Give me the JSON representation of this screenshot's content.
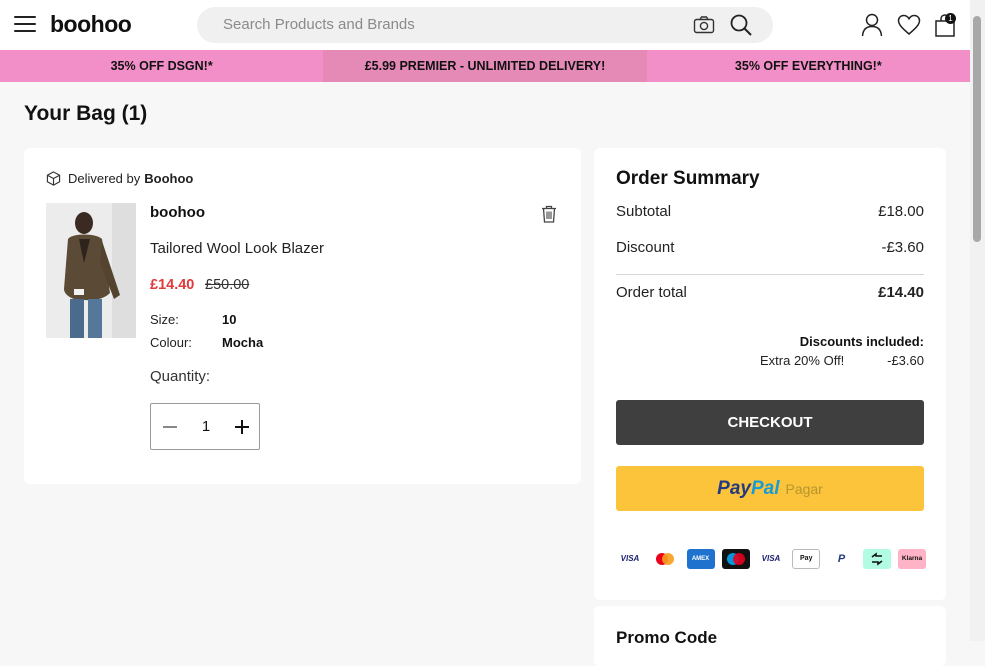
{
  "header": {
    "logo": "boohoo",
    "search_placeholder": "Search Products and Brands",
    "bag_count": "1"
  },
  "promo_bar": [
    "35% OFF DSGN!*",
    "£5.99 PREMIER - UNLIMITED DELIVERY!",
    "35% OFF EVERYTHING!*"
  ],
  "page": {
    "title": "Your Bag (1)"
  },
  "bag": {
    "delivered_by_label": "Delivered by",
    "delivered_by_name": "Boohoo",
    "item": {
      "brand": "boohoo",
      "name": "Tailored Wool Look Blazer",
      "price_now": "£14.40",
      "price_was": "£50.00",
      "size_label": "Size:",
      "size_value": "10",
      "colour_label": "Colour:",
      "colour_value": "Mocha",
      "quantity_label": "Quantity:",
      "quantity": "1"
    }
  },
  "summary": {
    "title": "Order Summary",
    "subtotal_label": "Subtotal",
    "subtotal_value": "£18.00",
    "discount_label": "Discount",
    "discount_value": "-£3.60",
    "total_label": "Order total",
    "total_value": "£14.40",
    "discounts_included_label": "Discounts included:",
    "discount_name": "Extra 20% Off!",
    "discount_amount": "-£3.60",
    "checkout_label": "CHECKOUT",
    "paypal_pay": "Pay",
    "paypal_pal": "Pal",
    "paypal_suffix": "Pagar",
    "payment_icons": [
      {
        "name": "visa-icon",
        "label": "VISA"
      },
      {
        "name": "mastercard-icon",
        "label": ""
      },
      {
        "name": "amex-icon",
        "label": "AMEX"
      },
      {
        "name": "maestro-icon",
        "label": ""
      },
      {
        "name": "visa-electron-icon",
        "label": "VISA"
      },
      {
        "name": "apple-pay-icon",
        "label": "Pay"
      },
      {
        "name": "paypal-icon",
        "label": "P"
      },
      {
        "name": "clearpay-icon",
        "label": ""
      },
      {
        "name": "klarna-icon",
        "label": "Klarna"
      }
    ]
  },
  "promo_code": {
    "title": "Promo Code"
  },
  "colors": {
    "promo_pink": "#f28fc8",
    "sale_red": "#e03a3a",
    "checkout_dark": "#3f3f3f",
    "paypal_yellow": "#fbc43a"
  }
}
